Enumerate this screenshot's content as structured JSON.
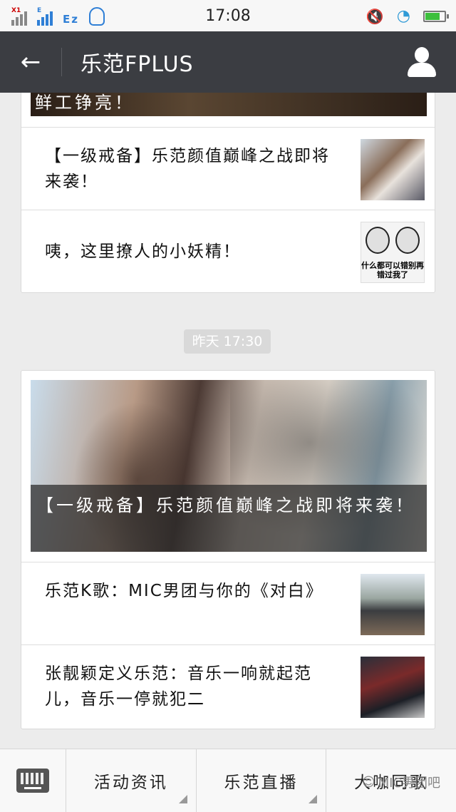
{
  "status_bar": {
    "time": "17:08",
    "sim1_tag": "X1",
    "sim2_tag": "E",
    "network": "Ez"
  },
  "header": {
    "back_icon": "←",
    "title": "乐范FPLUS"
  },
  "feed": {
    "top_card": {
      "hero_caption_partial": "鲜工铮亮！",
      "items": [
        {
          "title": "【一级戒备】乐范颜值巅峰之战即将来袭！"
        },
        {
          "title": "咦，这里撩人的小妖精！",
          "thumb_text": "什么都可以错别再错过我了"
        }
      ]
    },
    "timestamp": "昨天 17:30",
    "second_card": {
      "hero_caption": "【一级戒备】乐范颜值巅峰之战即将来袭！",
      "items": [
        {
          "title": "乐范K歌：MIC男团与你的《对白》"
        },
        {
          "title": "张靓颖定义乐范：音乐一响就起范儿，音乐一停就犯二"
        }
      ]
    }
  },
  "bottom_menu": {
    "items": [
      "活动资讯",
      "乐范直播",
      "大咖同歌"
    ]
  },
  "watermark": "MIC男团吧",
  "colors": {
    "title_bar": "#3b3d42",
    "background": "#ececec"
  }
}
